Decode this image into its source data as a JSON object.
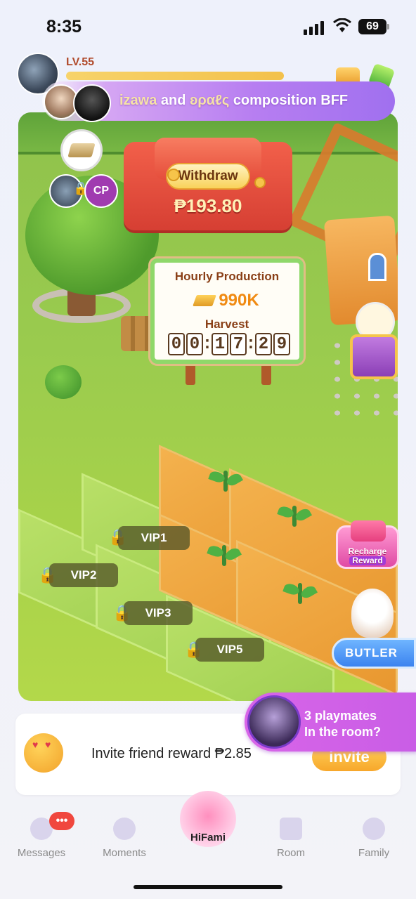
{
  "status_bar": {
    "time": "8:35",
    "battery": "69"
  },
  "profile": {
    "level": "LV.55"
  },
  "banner": {
    "name_left": "izawa",
    "conj": "and",
    "name_right": "ʚραℓς",
    "relation": "composition BFF"
  },
  "withdraw": {
    "button_label": "Withdraw",
    "amount": "₱193.80"
  },
  "production": {
    "title": "Hourly Production",
    "value": "990K",
    "harvest_label": "Harvest",
    "timer": [
      "0",
      "0",
      ":",
      "1",
      "7",
      ":",
      "2",
      "9"
    ]
  },
  "left_widget": {
    "badge": "CP"
  },
  "plots": {
    "vip1": "VIP1",
    "vip2": "VIP2",
    "vip3": "VIP3",
    "vip5": "VIP5"
  },
  "recharge": {
    "line1": "Recharge",
    "line2": "Reward"
  },
  "butler": {
    "label": "BUTLER"
  },
  "invite": {
    "text": "Invite friend reward ₱2.85",
    "button": "invite"
  },
  "playmates": {
    "line1": "3 playmates",
    "line2": "In the room?"
  },
  "tabs": [
    {
      "label": "Messages",
      "badge": "•••"
    },
    {
      "label": "Moments"
    },
    {
      "label": "HiFami"
    },
    {
      "label": "Room"
    },
    {
      "label": "Family"
    }
  ],
  "colors": {
    "accent": "#a070ef",
    "tab_active": "#222222",
    "tab_inactive": "#8a8a8a",
    "badge": "#f0473e"
  }
}
